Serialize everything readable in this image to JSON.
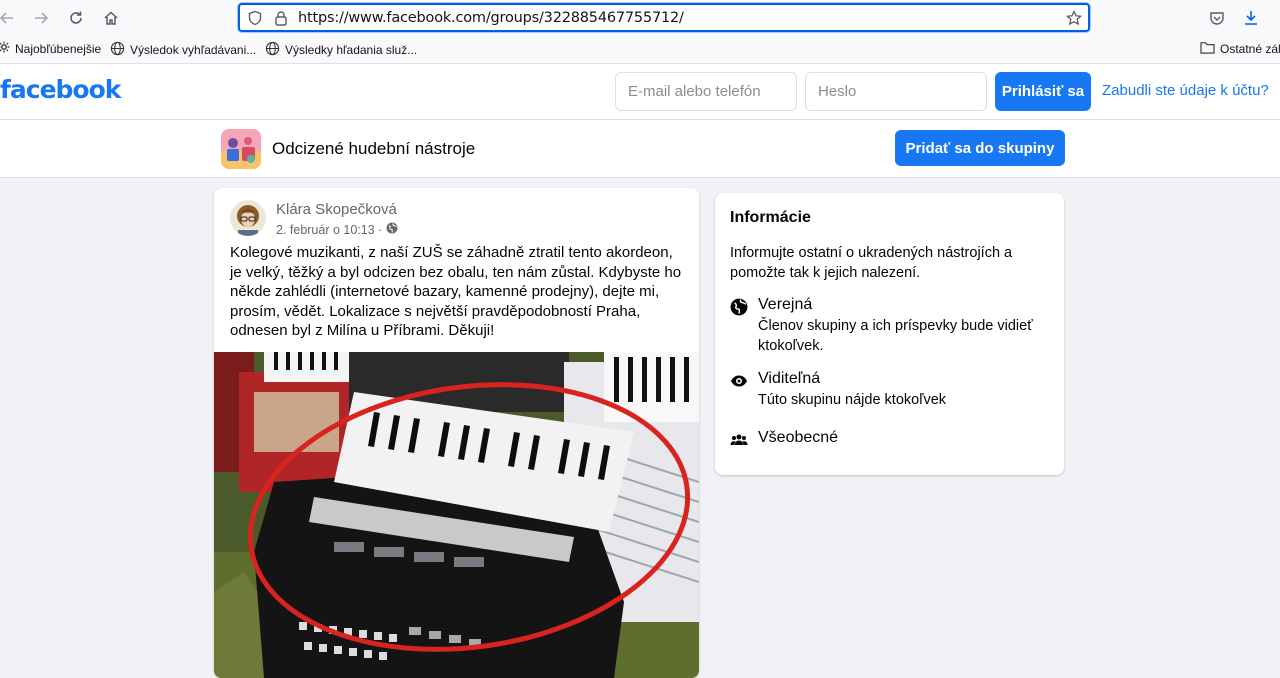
{
  "browser": {
    "url": "https://www.facebook.com/groups/322885467755712/",
    "bookmarks": [
      "Najobľúbenejšie",
      "Výsledok vyhľadávani...",
      "Výsledky hľadania služ...",
      "Ostatné zálc"
    ]
  },
  "header": {
    "logo": "facebook",
    "email_placeholder": "E-mail alebo telefón",
    "password_placeholder": "Heslo",
    "login_label": "Prihlásiť sa",
    "forgot_label": "Zabudli ste údaje k účtu?"
  },
  "group": {
    "name": "Odcizené hudební nástroje",
    "join_label": "Pridať sa do skupiny"
  },
  "post": {
    "author": "Klára Skopečková",
    "date": "2. február o 10:13 ·",
    "text": "Kolegové muzikanti, z naší ZUŠ se záhadně ztratil tento akordeon, je velký, těžký a byl odcizen bez obalu, ten nám zůstal. Kdybyste ho někde zahlédli (internetové bazary, kamenné prodejny), dejte mi, prosím, vědět. Lokalizace s největší pravděpodobností Praha, odnesen byl z Milína u Příbrami. Děkuji!"
  },
  "info": {
    "title": "Informácie",
    "description": "Informujte ostatní o ukradených nástrojích a pomožte tak k jejich nalezení.",
    "public_title": "Verejná",
    "public_desc": "Členov skupiny a ich príspevky bude vidieť ktokoľvek.",
    "visible_title": "Viditeľná",
    "visible_desc": "Túto skupinu nájde ktokoľvek",
    "general_title": "Všeobecné"
  },
  "colors": {
    "brand": "#1877f2",
    "page_bg": "#f0f2f5"
  }
}
